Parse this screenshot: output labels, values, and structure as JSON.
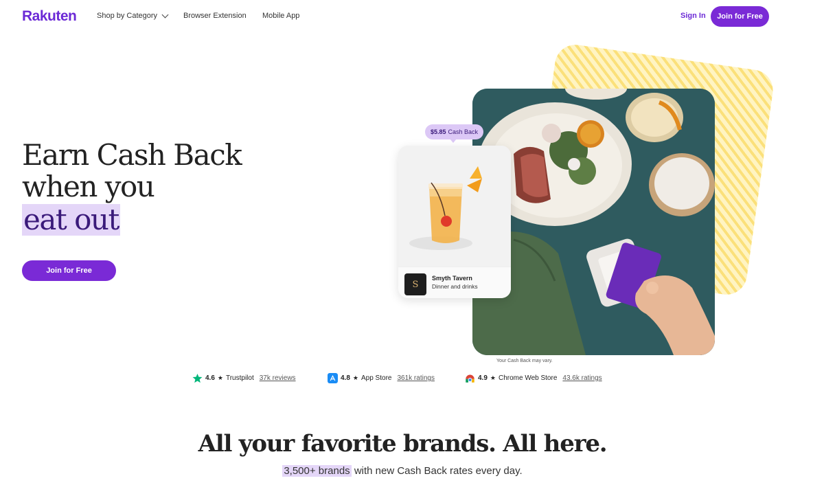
{
  "nav": {
    "logo": "Rakuten",
    "shop_by_category": "Shop by Category",
    "browser_extension": "Browser Extension",
    "mobile_app": "Mobile App",
    "sign_in": "Sign In",
    "join": "Join for Free"
  },
  "hero": {
    "line1": "Earn Cash Back",
    "line2": "when you",
    "line3": "eat out",
    "join": "Join for Free",
    "disclaimer": "Your Cash Back may vary."
  },
  "merchant": {
    "bubble_amount": "$5.85",
    "bubble_label": "Cash Back",
    "name": "Smyth Tavern",
    "description": "Dinner and drinks",
    "logo_letter": "S"
  },
  "ratings": [
    {
      "score": "4.6",
      "source": "Trustpilot",
      "link": "37k reviews",
      "icon": "trustpilot-star-icon"
    },
    {
      "score": "4.8",
      "source": "App Store",
      "link": "361k ratings",
      "icon": "app-store-icon"
    },
    {
      "score": "4.9",
      "source": "Chrome Web Store",
      "link": "43.6k ratings",
      "icon": "chrome-web-store-icon"
    }
  ],
  "brands": {
    "title": "All your favorite brands. All here.",
    "sub_highlight": "3,500+ brands",
    "sub_rest": " with new Cash Back rates every day."
  },
  "colors": {
    "brand_purple": "#7a2ad6",
    "highlight_lavender": "#e4d6f8",
    "stripe_yellow": "#fbe07a"
  }
}
